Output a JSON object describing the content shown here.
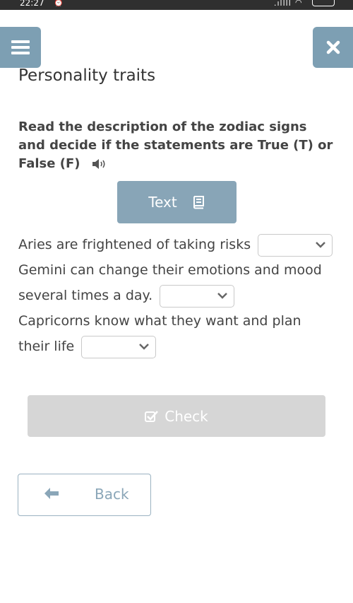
{
  "status_bar": {
    "time": "22:27"
  },
  "header": {
    "menu_icon": "hamburger-icon",
    "close_icon": "close-icon",
    "title": "Personality traits"
  },
  "instructions": {
    "text": "Read the description of the zodiac signs and decide if the statements are True (T) or False (F)",
    "audio_icon": "speaker-icon"
  },
  "text_button": {
    "label": "Text",
    "icon": "book-icon"
  },
  "questions": [
    {
      "text": "Aries are frightened of taking risks",
      "selected": ""
    },
    {
      "text": "Gemini can change their emotions and mood several times a day.",
      "selected": ""
    },
    {
      "text": "Capricorns know what they want and plan their life",
      "selected": ""
    }
  ],
  "check_button": {
    "label": "Check",
    "icon": "checkbox-icon"
  },
  "back_button": {
    "label": "Back",
    "icon": "arrow-left-icon"
  },
  "colors": {
    "accent": "#7d9fb3",
    "text_button": "#88a5b7",
    "check_disabled": "#d6d6d6",
    "text": "#444444"
  }
}
